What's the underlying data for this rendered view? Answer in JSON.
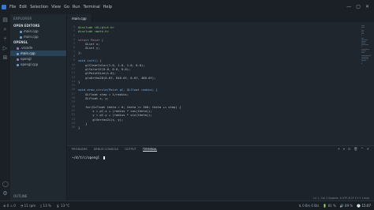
{
  "menubar": {
    "items": [
      "File",
      "Edit",
      "Selection",
      "View",
      "Go",
      "Run",
      "Terminal",
      "Help"
    ],
    "window_controls": [
      "—",
      "▢",
      "✕"
    ]
  },
  "sidebar": {
    "title": "EXPLORER",
    "sections": [
      {
        "label": "OPEN EDITORS",
        "items": [
          {
            "label": "main.cpp",
            "type": "cpp",
            "active": false
          },
          {
            "label": "main.cpp",
            "type": "cpp",
            "active": false
          }
        ]
      },
      {
        "label": "OPENGL",
        "items": [
          {
            "label": ".vscode",
            "type": "folder",
            "active": false
          },
          {
            "label": "main.cpp",
            "type": "cpp",
            "active": true
          },
          {
            "label": "opengl",
            "type": "file",
            "active": false
          },
          {
            "label": "opengl.cpp",
            "type": "cpp",
            "active": false
          }
        ]
      }
    ],
    "bottom": "OUTLINE"
  },
  "tabs": [
    {
      "label": "main.cpp",
      "active": true
    }
  ],
  "editor": {
    "lines": [
      {
        "text": "#include <GL/glut.h>",
        "kind": "pp"
      },
      {
        "text": "#include <math.h>",
        "kind": "pp"
      },
      {
        "text": "",
        "kind": ""
      },
      {
        "text": "struct Point {",
        "kind": "kw"
      },
      {
        "text": "    GLint x;",
        "kind": ""
      },
      {
        "text": "    GLint y;",
        "kind": ""
      },
      {
        "text": "};",
        "kind": ""
      },
      {
        "text": "",
        "kind": ""
      },
      {
        "text": "void init() {",
        "kind": "fn"
      },
      {
        "text": "    glClearColor(1.0, 1.0, 1.0, 0.0);",
        "kind": ""
      },
      {
        "text": "    glColor3f(0.0, 0.0, 0.0);",
        "kind": ""
      },
      {
        "text": "    glPointSize(1.0);",
        "kind": ""
      },
      {
        "text": "    gluOrtho2D(0.0f, 640.0f, 0.0f, 480.0f);",
        "kind": ""
      },
      {
        "text": "}",
        "kind": ""
      },
      {
        "text": "",
        "kind": ""
      },
      {
        "text": "void draw_circle(Point pC, GLfloat radius) {",
        "kind": "fn"
      },
      {
        "text": "    GLfloat step = 1/radius;",
        "kind": ""
      },
      {
        "text": "    GLfloat x, y;",
        "kind": ""
      },
      {
        "text": "",
        "kind": ""
      },
      {
        "text": "    for(GLfloat theta = 0; theta <= 360; theta += step) {",
        "kind": ""
      },
      {
        "text": "        x = pC.x + (radius * cos(theta));",
        "kind": ""
      },
      {
        "text": "        y = pC.y + (radius * sin(theta));",
        "kind": ""
      },
      {
        "text": "        glVertex2i(x, y);",
        "kind": ""
      },
      {
        "text": "    }",
        "kind": ""
      },
      {
        "text": "}",
        "kind": ""
      }
    ]
  },
  "panel": {
    "tabs": [
      {
        "label": "PROBLEMS",
        "active": false
      },
      {
        "label": "DEBUG CONSOLE",
        "active": false
      },
      {
        "label": "OUTPUT",
        "active": false
      },
      {
        "label": "TERMINAL",
        "active": true
      }
    ],
    "actions": [
      "+",
      "▾",
      "⊟",
      "🗑",
      "^",
      "✕"
    ],
    "terminal_line": "~/d/t/c/opengl "
  },
  "editor_status": "Ln 1, Col 1  Spaces: 4  UTF-8  LF  C++  Linux",
  "statusbar": {
    "left": [
      "⊗ 0  ⚠ 0",
      "◔ 11 rpm",
      "▯ 13 %",
      "🌡 13 °C"
    ],
    "right": [
      "⇅ 0 B/s  0 B/s",
      "🔋 81 %",
      "🔊 89 %",
      "🕓 15:07"
    ]
  }
}
